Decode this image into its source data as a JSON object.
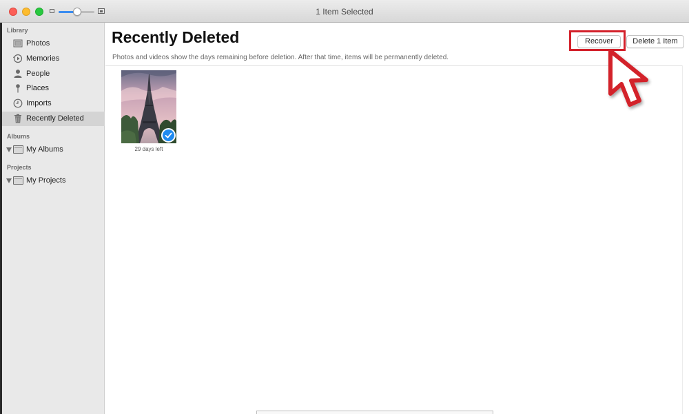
{
  "window": {
    "title": "1 Item Selected"
  },
  "sidebar": {
    "library_header": "Library",
    "library_items": [
      {
        "label": "Photos",
        "icon": "photos-icon"
      },
      {
        "label": "Memories",
        "icon": "memories-icon"
      },
      {
        "label": "People",
        "icon": "people-icon"
      },
      {
        "label": "Places",
        "icon": "places-icon"
      },
      {
        "label": "Imports",
        "icon": "imports-icon"
      },
      {
        "label": "Recently Deleted",
        "icon": "trash-icon",
        "selected": true
      }
    ],
    "albums_header": "Albums",
    "albums_item": "My Albums",
    "projects_header": "Projects",
    "projects_item": "My Projects"
  },
  "main": {
    "title": "Recently Deleted",
    "subtitle": "Photos and videos show the days remaining before deletion. After that time, items will be permanently deleted.",
    "recover_label": "Recover",
    "delete_label": "Delete 1 Item",
    "photo": {
      "caption": "29 days left",
      "selected": true
    }
  },
  "colors": {
    "accent": "#1f8bf0",
    "highlight": "#d3202a",
    "sidebar_bg": "#e9e9e9"
  },
  "zoom_slider": {
    "level": 0.45
  }
}
